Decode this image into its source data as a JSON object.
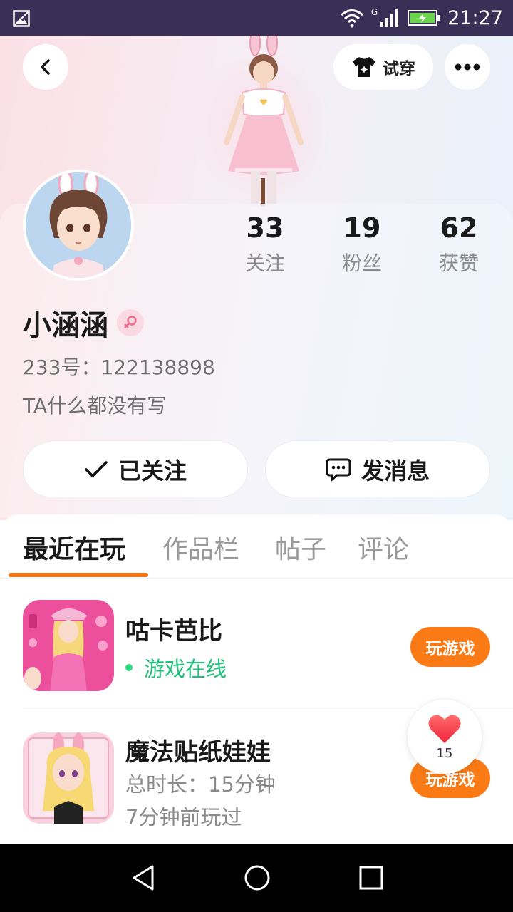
{
  "status_bar": {
    "time": "21:27",
    "network": "G"
  },
  "header": {
    "tryon_label": "试穿"
  },
  "profile": {
    "name": "小涵涵",
    "uid": "233号：122138898",
    "bio": "TA什么都没有写",
    "stats": [
      {
        "value": "33",
        "label": "关注"
      },
      {
        "value": "19",
        "label": "粉丝"
      },
      {
        "value": "62",
        "label": "获赞"
      }
    ]
  },
  "actions": {
    "follow_label": "已关注",
    "message_label": "发消息"
  },
  "tabs": [
    "最近在玩",
    "作品栏",
    "帖子",
    "评论"
  ],
  "games": [
    {
      "title": "咕卡芭比",
      "status": "游戏在线",
      "button": "玩游戏"
    },
    {
      "title": "魔法贴纸娃娃",
      "duration": "总时长：15分钟",
      "last_played": "7分钟前玩过",
      "button": "玩游戏"
    }
  ],
  "like_float": {
    "count": "15"
  },
  "colors": {
    "accent": "#f57411",
    "online": "#1ec27a",
    "status_bar": "#3a2f57"
  }
}
